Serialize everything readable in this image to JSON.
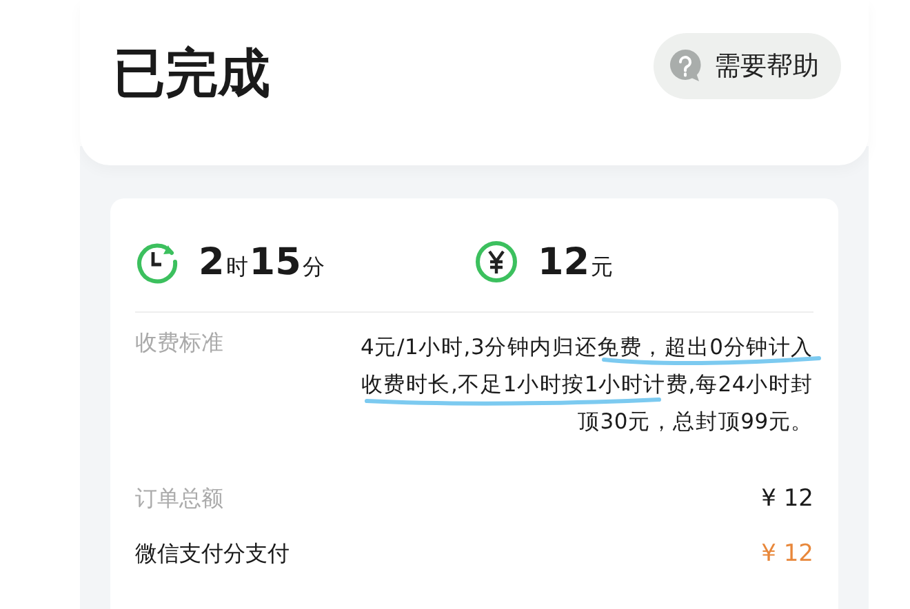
{
  "header": {
    "title": "已完成",
    "help_button": "需要帮助"
  },
  "summary": {
    "duration": {
      "hours": "2",
      "hour_unit": "时",
      "minutes": "15",
      "minute_unit": "分"
    },
    "amount": {
      "value": "12",
      "unit": "元"
    }
  },
  "details": [
    {
      "kind": "fee_rule",
      "label": "收费标准",
      "lines": [
        "4元/1小时,3分钟内归还免费，超出0分钟计入",
        "收费时长,不足1小时按1小时计费,每24小时封",
        "顶30元，总封顶99元。"
      ]
    },
    {
      "kind": "amount",
      "label": "订单总额",
      "value": "¥ 12",
      "emphasis": false
    },
    {
      "kind": "amount",
      "label": "微信支付分支付",
      "value": "¥ 12",
      "emphasis": true
    }
  ]
}
